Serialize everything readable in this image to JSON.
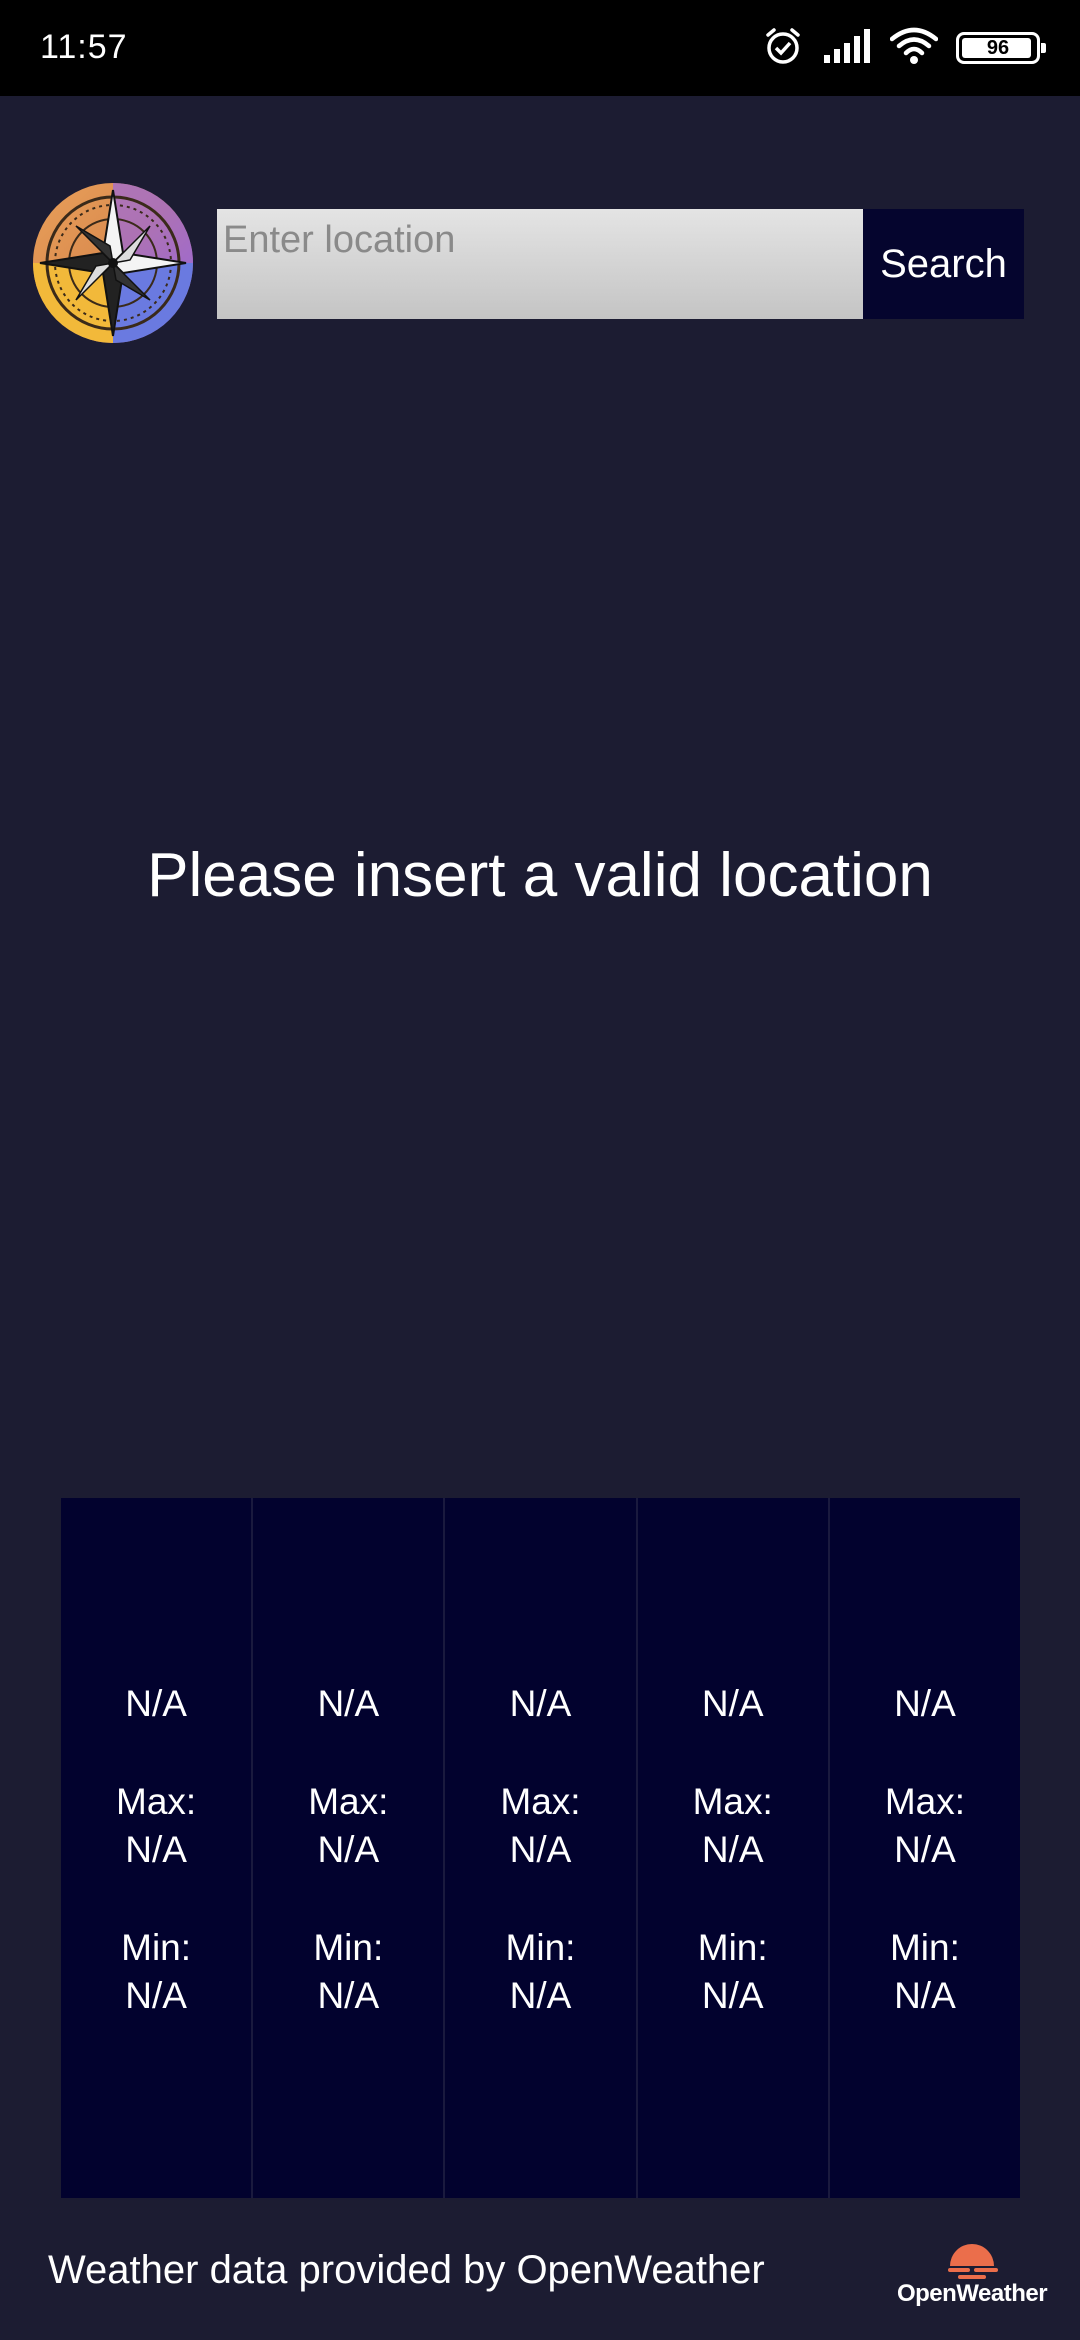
{
  "status_bar": {
    "time": "11:57",
    "battery_level": "96",
    "battery_fraction": 0.96,
    "icons": [
      "alarm-icon",
      "signal-icon",
      "wifi-icon",
      "battery-icon"
    ]
  },
  "header": {
    "logo_icon": "compass-rose-logo",
    "search_placeholder": "Enter location",
    "search_value": "",
    "search_button_label": "Search"
  },
  "main": {
    "message": "Please insert a valid location"
  },
  "forecast": {
    "days": [
      {
        "condition": "N/A",
        "max_label": "Max:",
        "max_value": "N/A",
        "min_label": "Min:",
        "min_value": "N/A"
      },
      {
        "condition": "N/A",
        "max_label": "Max:",
        "max_value": "N/A",
        "min_label": "Min:",
        "min_value": "N/A"
      },
      {
        "condition": "N/A",
        "max_label": "Max:",
        "max_value": "N/A",
        "min_label": "Min:",
        "min_value": "N/A"
      },
      {
        "condition": "N/A",
        "max_label": "Max:",
        "max_value": "N/A",
        "min_label": "Min:",
        "min_value": "N/A"
      },
      {
        "condition": "N/A",
        "max_label": "Max:",
        "max_value": "N/A",
        "min_label": "Min:",
        "min_value": "N/A"
      }
    ]
  },
  "footer": {
    "attribution": "Weather data provided by OpenWeather",
    "brand_logo_text": "OpenWeather"
  },
  "colors": {
    "background": "#1c1c32",
    "status_bar": "#000000",
    "card_background": "#02022e",
    "search_button": "#05052e",
    "brand_accent": "#eb6e4b"
  }
}
